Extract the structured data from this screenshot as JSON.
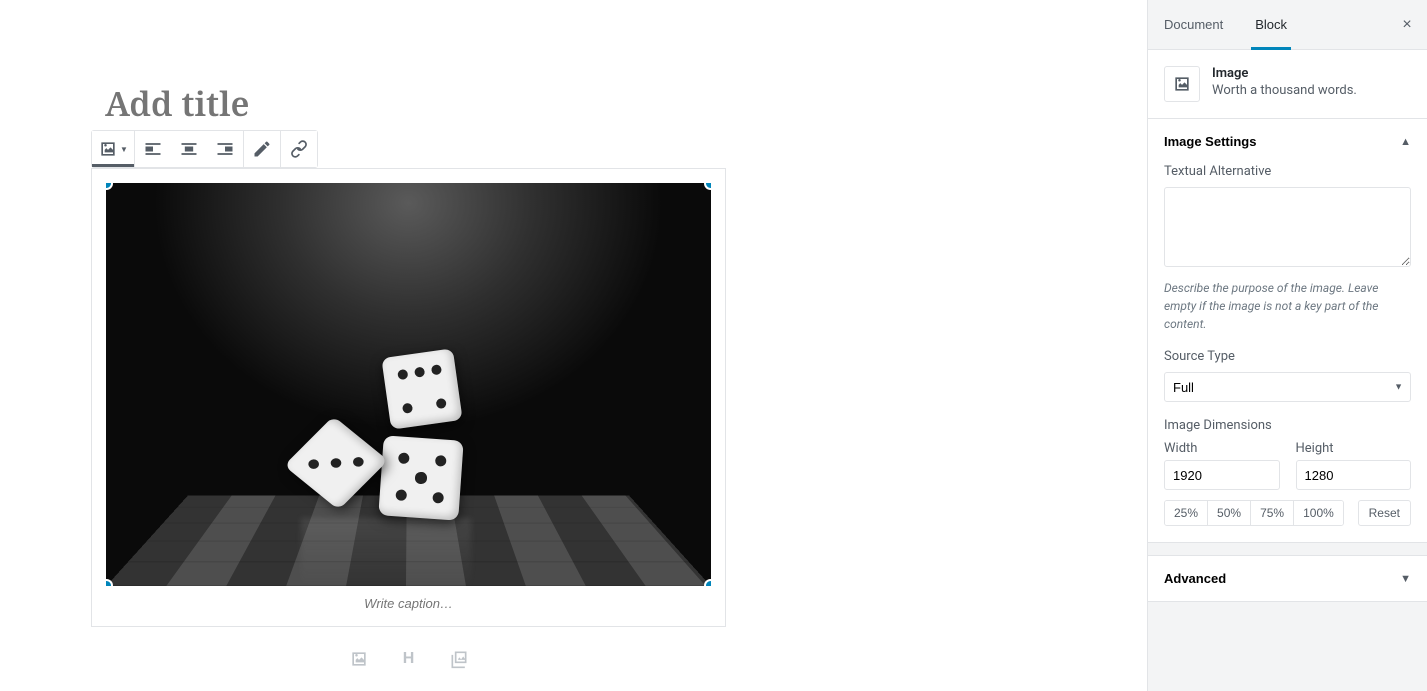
{
  "editor": {
    "title_placeholder": "Add title",
    "caption_placeholder": "Write caption…",
    "inserter": {
      "heading_letter": "H"
    }
  },
  "sidebar": {
    "tabs": {
      "document": "Document",
      "block": "Block"
    },
    "close_label": "×",
    "block_info": {
      "title": "Image",
      "description": "Worth a thousand words."
    },
    "panels": {
      "image_settings": "Image Settings",
      "advanced": "Advanced"
    },
    "alt_text": {
      "label": "Textual Alternative",
      "value": "",
      "help": "Describe the purpose of the image. Leave empty if the image is not a key part of the content."
    },
    "source_type": {
      "label": "Source Type",
      "value": "Full"
    },
    "dimensions": {
      "label": "Image Dimensions",
      "width_label": "Width",
      "height_label": "Height",
      "width_value": "1920",
      "height_value": "1280",
      "percent_25": "25%",
      "percent_50": "50%",
      "percent_75": "75%",
      "percent_100": "100%",
      "reset": "Reset"
    }
  }
}
